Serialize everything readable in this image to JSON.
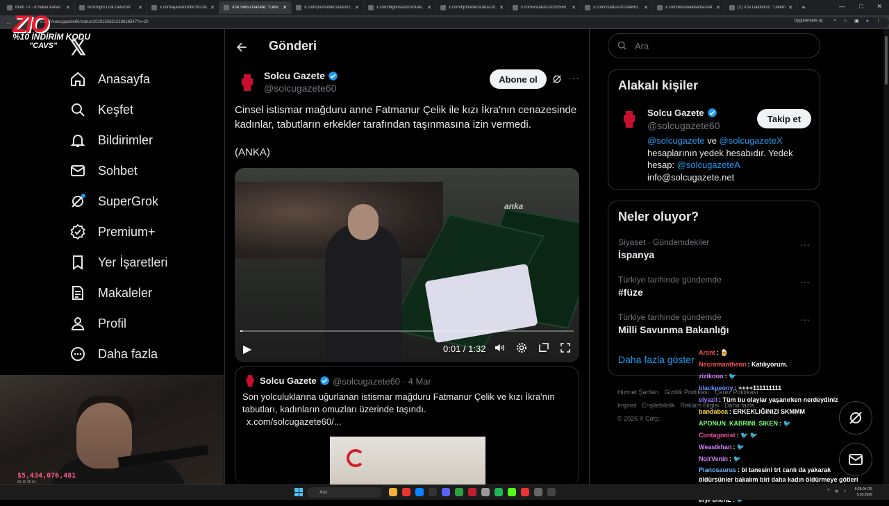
{
  "browser": {
    "tabs": [
      {
        "title": "Multi TV - 6 haber kanalı",
        "active": false
      },
      {
        "title": "KickSight Link Detector",
        "active": false
      },
      {
        "title": "x.com/ajansmuhbir1923/s",
        "active": false
      },
      {
        "title": "X'te Solcu Gazete: \"Cinsi",
        "active": true
      },
      {
        "title": "x.com/pusholder/status/2",
        "active": false
      },
      {
        "title": "x.com/bigbossdozu/statu",
        "active": false
      },
      {
        "title": "x.com/bpthaber/status/20",
        "active": false
      },
      {
        "title": "x.com/i/status/20292560",
        "active": false
      },
      {
        "title": "x.com/i/status/20294861",
        "active": false
      },
      {
        "title": "x.com/bosunatiklama/stat",
        "active": false
      },
      {
        "title": "(2) X'te Daktiloclc: \"Ülkem",
        "active": false
      }
    ],
    "url": "x.com/solcugazete60/status/2029155831518818547?s=20",
    "open_in_app": "Uygulamada aç"
  },
  "overlay": {
    "logo": "ZIO",
    "promo_line1": "%10 İNDİRİM KODU",
    "promo_line2": "\"CAVS\"",
    "money": "$5,434,076,481",
    "stats": "83   10   25   94"
  },
  "sidebar": {
    "items": [
      {
        "label": "Anasayfa",
        "icon": "home-icon"
      },
      {
        "label": "Keşfet",
        "icon": "search-icon"
      },
      {
        "label": "Bildirimler",
        "icon": "bell-icon"
      },
      {
        "label": "Sohbet",
        "icon": "mail-icon"
      },
      {
        "label": "SuperGrok",
        "icon": "grok-icon"
      },
      {
        "label": "Premium+",
        "icon": "verified-icon"
      },
      {
        "label": "Yer İşaretleri",
        "icon": "bookmark-icon"
      },
      {
        "label": "Makaleler",
        "icon": "article-icon"
      },
      {
        "label": "Profil",
        "icon": "person-icon"
      },
      {
        "label": "Daha fazla",
        "icon": "more-circle-icon"
      }
    ]
  },
  "main": {
    "title": "Gönderi",
    "post": {
      "author": "Solcu Gazete",
      "handle": "@solcugazete60",
      "subscribe_label": "Abone ol",
      "text": "Cinsel istismar mağduru anne Fatmanur Çelik ile kızı İkra'nın cenazesinde kadınlar, tabutların erkekler tarafından taşınmasına izin vermedi.",
      "source": "(ANKA)",
      "video": {
        "watermark": "anka",
        "time": "0:01 / 1:32",
        "progress": 0.01
      }
    },
    "quote": {
      "author": "Solcu Gazete",
      "handle": "@solcugazete60",
      "date": "4 Mar",
      "text": "Son yolculuklarına uğurlanan istismar mağduru Fatmanur Çelik ve kızı İkra'nın tabutları, kadınların omuzları üzerinde taşındı.",
      "link": "x.com/solcugazete60/..."
    }
  },
  "right": {
    "search_placeholder": "Ara",
    "related": {
      "title": "Alakalı kişiler",
      "name": "Solcu Gazete",
      "handle": "@solcugazete60",
      "follow_label": "Takip et",
      "bio_link1": "@solcugazete",
      "bio_and": " ve ",
      "bio_link2": "@solcugazeteX",
      "bio_mid": " hesaplarının yedek hesabıdır. Yedek hesap: ",
      "bio_link3": "@solcugazeteA",
      "bio_email": "info@solcugazete.net"
    },
    "trends": {
      "title": "Neler oluyor?",
      "items": [
        {
          "context": "Siyaset · Gündemdekiler",
          "name": "İspanya"
        },
        {
          "context": "Türkiye tarihinde gündemde",
          "name": "#füze"
        },
        {
          "context": "Türkiye tarihinde gündemde",
          "name": "Milli Savunma Bakanlığı"
        }
      ],
      "show_more": "Daha fazla göster"
    },
    "footer": {
      "links": [
        "Hizmet Şartları",
        "Gizlilik Politikası",
        "Çerez Politikası",
        "Imprint",
        "Erişilebilirlik",
        "Reklam bilgisi",
        "Daha fazla ..."
      ],
      "copyright": "© 2026 X Corp."
    }
  },
  "chat": [
    {
      "user": "Arsnt",
      "msg": "🍺",
      "color": "#ff4f4f"
    },
    {
      "user": "Necromantheon",
      "msg": "Katılıyorum.",
      "color": "#ff4f4f"
    },
    {
      "user": "zizikooo",
      "msg": "🐦",
      "color": "#d97cff"
    },
    {
      "user": "blackpeony",
      "msg": "++++111111111",
      "color": "#6f8bff"
    },
    {
      "user": "elyazli",
      "msg": "Tüm bu olaylar yaşanırken nerdeydiniz",
      "color": "#9b7cff"
    },
    {
      "user": "bandabea",
      "msg": "ERKEKLIĞINIZI SKMMM",
      "color": "#ffd54a"
    },
    {
      "user": "APONUN_KABRINI_SIKEN",
      "msg": "🐦",
      "color": "#7cff7c"
    },
    {
      "user": "Contagonist",
      "msg": "🐦 🐦",
      "color": "#ff4fa8"
    },
    {
      "user": "Weastkhan",
      "msg": "🐦",
      "color": "#d97cff"
    },
    {
      "user": "NoirVenin",
      "msg": "🐦",
      "color": "#d97cff"
    },
    {
      "user": "Pianosaurus",
      "msg": "bi tanesini trt canlı da yakarak öldürsünler bakalım biri daha kadın öldürmeye götleri yiyecek mi",
      "color": "#6fb4ff"
    },
    {
      "user": "eryPunchL",
      "msg": "🐦",
      "color": "#ffffff"
    }
  ],
  "taskbar": {
    "search": "Ara",
    "time": "5:25:04 ÖS",
    "date": "5.03.2026"
  },
  "colors": {
    "accent": "#1d9bf0",
    "background": "#000000",
    "text": "#e7e9ea",
    "muted": "#71767b"
  }
}
